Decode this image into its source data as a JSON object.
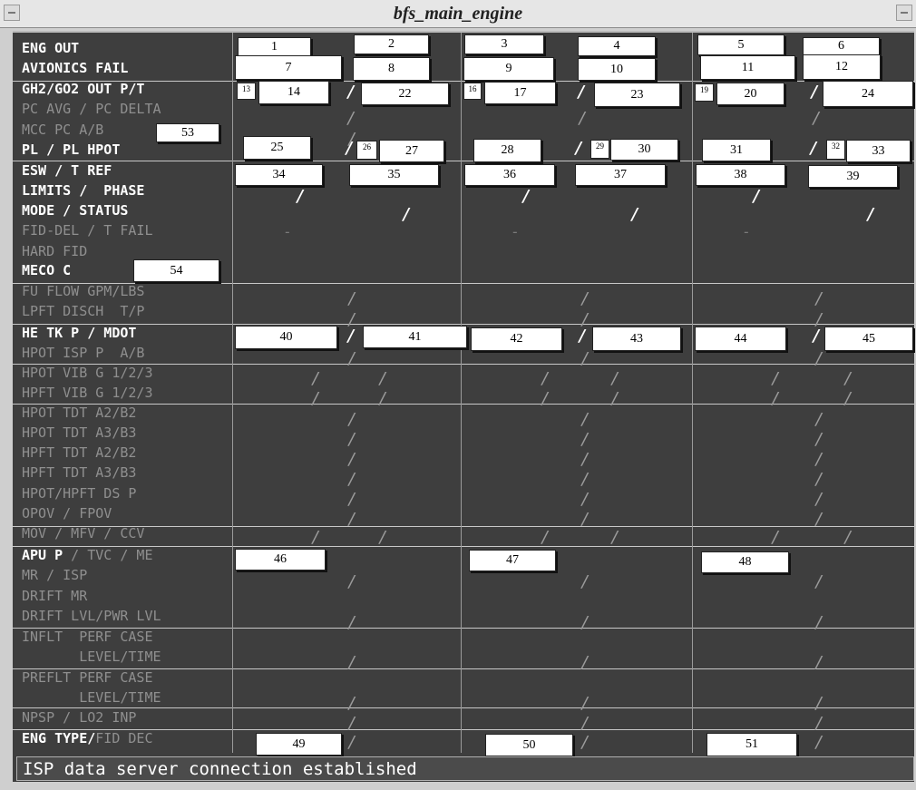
{
  "window": {
    "title": "bfs_main_engine"
  },
  "labels": [
    {
      "text": "ENG OUT",
      "white": true
    },
    {
      "text": "AVIONICS FAIL",
      "white": true
    },
    {
      "text": "GH2/GO2 OUT P/T",
      "white": true
    },
    {
      "text": "PC AVG / PC DELTA",
      "white": false
    },
    {
      "text": "MCC PC A/B",
      "white": false
    },
    {
      "text": "PL / PL HPOT",
      "white": true
    },
    {
      "text": "ESW / T REF",
      "white": true
    },
    {
      "text": "LIMITS /  PHASE",
      "white": true
    },
    {
      "text": "MODE / STATUS",
      "white": true
    },
    {
      "text": "FID-DEL / T FAIL",
      "white": false
    },
    {
      "text": "HARD FID",
      "white": false
    },
    {
      "text": "MECO C",
      "white": true
    },
    {
      "text": "FU FLOW GPM/LBS",
      "white": false
    },
    {
      "text": "LPFT DISCH  T/P",
      "white": false
    },
    {
      "text": "HE TK P / MDOT",
      "white": true
    },
    {
      "text": "HPOT ISP P  A/B",
      "white": false
    },
    {
      "text": "HPOT VIB G 1/2/3",
      "white": false
    },
    {
      "text": "HPFT VIB G 1/2/3",
      "white": false
    },
    {
      "text": "HPOT TDT A2/B2",
      "white": false
    },
    {
      "text": "HPOT TDT A3/B3",
      "white": false
    },
    {
      "text": "HPFT TDT A2/B2",
      "white": false
    },
    {
      "text": "HPFT TDT A3/B3",
      "white": false
    },
    {
      "text": "HPOT/HPFT DS P",
      "white": false
    },
    {
      "text": "OPOV / FPOV",
      "white": false
    },
    {
      "text": "MOV / MFV / CCV",
      "white": false
    },
    {
      "text": "APU P",
      "white": true
    },
    {
      "text": "MR / ISP",
      "white": false
    },
    {
      "text": "DRIFT MR",
      "white": false
    },
    {
      "text": "DRIFT LVL/PWR LVL",
      "white": false
    },
    {
      "text": "INFLT  PERF CASE",
      "white": false
    },
    {
      "text": "       LEVEL/TIME",
      "white": false
    },
    {
      "text": "PREFLT PERF CASE",
      "white": false
    },
    {
      "text": "       LEVEL/TIME",
      "white": false
    },
    {
      "text": "NPSP / LO2 INP",
      "white": false
    },
    {
      "text": "ENG TYPE/",
      "white": true
    }
  ],
  "label_suffixes": {
    "apu": " / TVC / ME",
    "engtype": "FID DEC"
  },
  "fields": [
    "1",
    "2",
    "3",
    "4",
    "5",
    "6",
    "7",
    "8",
    "9",
    "10",
    "11",
    "12",
    "13",
    "14",
    "16",
    "17",
    "19",
    "20",
    "22",
    "23",
    "24",
    "25",
    "26",
    "27",
    "28",
    "29",
    "30",
    "31",
    "32",
    "33",
    "34",
    "35",
    "36",
    "37",
    "38",
    "39",
    "40",
    "41",
    "42",
    "43",
    "44",
    "45",
    "46",
    "47",
    "48",
    "49",
    "50",
    "51",
    "53",
    "54"
  ],
  "separators": {
    "slash": "/",
    "dash": "-"
  },
  "status_bar": {
    "message": "ISP data server connection established"
  }
}
